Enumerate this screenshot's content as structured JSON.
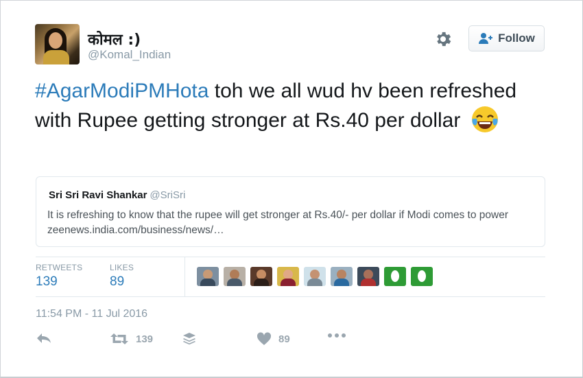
{
  "user": {
    "name": "कोमल :)",
    "handle": "@Komal_Indian",
    "avatar_icon": "profile-photo"
  },
  "header": {
    "settings_icon": "gear-icon",
    "follow_label": "Follow",
    "follow_icon": "add-user-icon"
  },
  "tweet": {
    "hashtag": "#AgarModiPMHota",
    "text": " toh we all wud hv been refreshed with Rupee getting stronger at Rs.40 per dollar",
    "emoji_icon": "face-with-tears-of-joy-emoji"
  },
  "quote": {
    "name": "Sri Sri Ravi Shankar",
    "handle": "@SriSri",
    "text": "It is refreshing to know that the rupee will get stronger at Rs.40/- per dollar if Modi comes to power zeenews.india.com/business/news/…"
  },
  "stats": {
    "retweets_label": "RETWEETS",
    "retweets_count": "139",
    "likes_label": "LIKES",
    "likes_count": "89"
  },
  "timestamp": "11:54 PM - 11 Jul 2016",
  "actions": {
    "reply_icon": "reply-icon",
    "retweet_icon": "retweet-icon",
    "retweet_count": "139",
    "buffer_icon": "layers-icon",
    "like_icon": "heart-icon",
    "like_count": "89",
    "more_icon": "more-dots-icon"
  },
  "colors": {
    "link_blue": "#2b7bb9",
    "muted_gray": "#8899a6",
    "text_dark": "#14171a",
    "egg_green": "#2e9b35"
  }
}
